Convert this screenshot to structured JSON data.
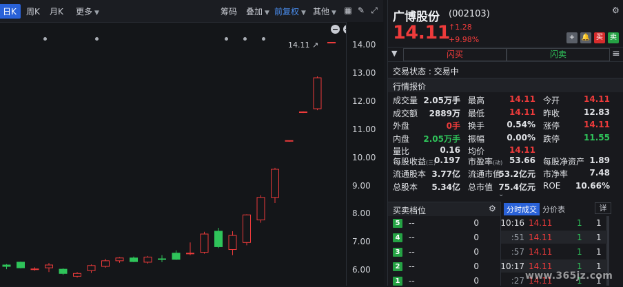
{
  "toolbar": {
    "day": "日K",
    "week": "周K",
    "month": "月K",
    "more": "更多",
    "chips": "筹码",
    "overlay": "叠加",
    "fuquan": "前复权",
    "other": "其他"
  },
  "chart": {
    "last_price_tag": "14.11",
    "y_ticks": [
      "14.00",
      "13.00",
      "12.00",
      "11.00",
      "10.00",
      "9.00",
      "8.00",
      "7.00",
      "6.00"
    ],
    "candles": [
      {
        "o": 6.2,
        "c": 6.15,
        "h": 6.23,
        "l": 6.05,
        "up": false
      },
      {
        "o": 6.1,
        "c": 6.3,
        "h": 6.32,
        "l": 6.08,
        "up": false
      },
      {
        "o": 6.05,
        "c": 6.06,
        "h": 6.12,
        "l": 6.0,
        "up": true
      },
      {
        "o": 6.1,
        "c": 6.2,
        "h": 6.27,
        "l": 5.95,
        "up": true
      },
      {
        "o": 6.05,
        "c": 5.9,
        "h": 6.08,
        "l": 5.85,
        "up": false
      },
      {
        "o": 5.9,
        "c": 5.8,
        "h": 5.95,
        "l": 5.75,
        "up": true
      },
      {
        "o": 6.0,
        "c": 6.18,
        "h": 6.22,
        "l": 5.92,
        "up": true
      },
      {
        "o": 6.15,
        "c": 6.35,
        "h": 6.42,
        "l": 6.1,
        "up": true
      },
      {
        "o": 6.35,
        "c": 6.45,
        "h": 6.48,
        "l": 6.28,
        "up": true
      },
      {
        "o": 6.45,
        "c": 6.32,
        "h": 6.5,
        "l": 6.3,
        "up": false
      },
      {
        "o": 6.3,
        "c": 6.48,
        "h": 6.52,
        "l": 6.25,
        "up": true
      },
      {
        "o": 6.4,
        "c": 6.42,
        "h": 6.55,
        "l": 6.3,
        "up": false
      },
      {
        "o": 6.4,
        "c": 6.62,
        "h": 6.72,
        "l": 6.38,
        "up": false
      },
      {
        "o": 6.6,
        "c": 6.62,
        "h": 7.0,
        "l": 6.55,
        "up": true
      },
      {
        "o": 6.65,
        "c": 7.3,
        "h": 7.38,
        "l": 6.6,
        "up": true
      },
      {
        "o": 6.85,
        "c": 7.4,
        "h": 7.52,
        "l": 6.8,
        "up": false
      },
      {
        "o": 6.75,
        "c": 7.25,
        "h": 7.4,
        "l": 6.55,
        "up": true
      },
      {
        "o": 7.0,
        "c": 7.98,
        "h": 8.0,
        "l": 6.9,
        "up": true
      },
      {
        "o": 7.8,
        "c": 8.6,
        "h": 8.68,
        "l": 7.7,
        "up": true
      },
      {
        "o": 8.6,
        "c": 9.6,
        "h": 9.65,
        "l": 8.4,
        "up": true
      },
      {
        "o": 10.6,
        "c": 10.62,
        "h": 10.62,
        "l": 10.58,
        "up": true
      },
      {
        "o": 11.62,
        "c": 11.64,
        "h": 11.66,
        "l": 11.6,
        "up": true
      },
      {
        "o": 11.75,
        "c": 12.85,
        "h": 12.9,
        "l": 11.7,
        "up": true
      },
      {
        "o": 14.11,
        "c": 14.11,
        "h": 14.11,
        "l": 14.11,
        "up": true
      }
    ]
  },
  "stock": {
    "name": "广博股份",
    "code": "(002103)",
    "price": "14.11",
    "change_abs": "1.28",
    "change_pct": "+9.98%",
    "btn_buy": "买",
    "btn_sell": "卖"
  },
  "flash": {
    "buy": "闪买",
    "sell": "闪卖"
  },
  "status": "交易状态 : 交易中",
  "quote_section": "行情报价",
  "quote_rows": [
    [
      {
        "l": "成交量",
        "v": "2.05万手",
        "c": ""
      },
      {
        "l": "最高",
        "v": "14.11",
        "c": "red"
      },
      {
        "l": "今开",
        "v": "14.11",
        "c": "red"
      }
    ],
    [
      {
        "l": "成交额",
        "v": "2889万",
        "c": ""
      },
      {
        "l": "最低",
        "v": "14.11",
        "c": "red"
      },
      {
        "l": "昨收",
        "v": "12.83",
        "c": ""
      }
    ],
    [
      {
        "l": "外盘",
        "v": "0手",
        "c": "red"
      },
      {
        "l": "换手",
        "v": "0.54%",
        "c": ""
      },
      {
        "l": "涨停",
        "v": "14.11",
        "c": "red"
      }
    ],
    [
      {
        "l": "内盘",
        "v": "2.05万手",
        "c": "green"
      },
      {
        "l": "振幅",
        "v": "0.00%",
        "c": ""
      },
      {
        "l": "跌停",
        "v": "11.55",
        "c": "green"
      }
    ],
    [
      {
        "l": "量比",
        "v": "0.16",
        "c": ""
      },
      {
        "l": "均价",
        "v": "14.11",
        "c": "red"
      },
      {
        "l": "",
        "v": "",
        "c": ""
      }
    ]
  ],
  "fund_rows": [
    [
      {
        "l": "每股收益",
        "s": "(三)",
        "v": "0.197"
      },
      {
        "l": "市盈率",
        "s": "(动)",
        "v": "53.66"
      },
      {
        "l": "每股净资产",
        "s": "",
        "v": "1.89"
      }
    ],
    [
      {
        "l": "流通股本",
        "s": "",
        "v": "3.77亿"
      },
      {
        "l": "流通市值",
        "s": "",
        "v": "53.2亿元"
      },
      {
        "l": "市净率",
        "s": "",
        "v": "7.48"
      }
    ],
    [
      {
        "l": "总股本",
        "s": "",
        "v": "5.34亿"
      },
      {
        "l": "总市值",
        "s": "",
        "v": "75.4亿元"
      },
      {
        "l": "ROE",
        "s": "",
        "v": "10.66%"
      }
    ]
  ],
  "order_book": {
    "title": "买卖档位",
    "levels": [
      {
        "n": "5",
        "p": "--",
        "v": "0"
      },
      {
        "n": "4",
        "p": "--",
        "v": "0"
      },
      {
        "n": "3",
        "p": "--",
        "v": "0"
      },
      {
        "n": "2",
        "p": "--",
        "v": "0"
      },
      {
        "n": "1",
        "p": "--",
        "v": "0"
      }
    ]
  },
  "trades": {
    "tab_fenshi": "分时成交",
    "tab_fenjia": "分价表",
    "detail": "详",
    "rows": [
      {
        "t": "10:16",
        "p": "14.11",
        "v": "1",
        "n": "1"
      },
      {
        "t": ":51",
        "p": "14.11",
        "v": "1",
        "n": "1"
      },
      {
        "t": ":57",
        "p": "14.11",
        "v": "1",
        "n": "1"
      },
      {
        "t": "10:17",
        "p": "14.11",
        "v": "1",
        "n": "1"
      },
      {
        "t": ":27",
        "p": "14.11",
        "v": "1",
        "n": "1"
      }
    ]
  },
  "watermark": "www.365jz.com"
}
